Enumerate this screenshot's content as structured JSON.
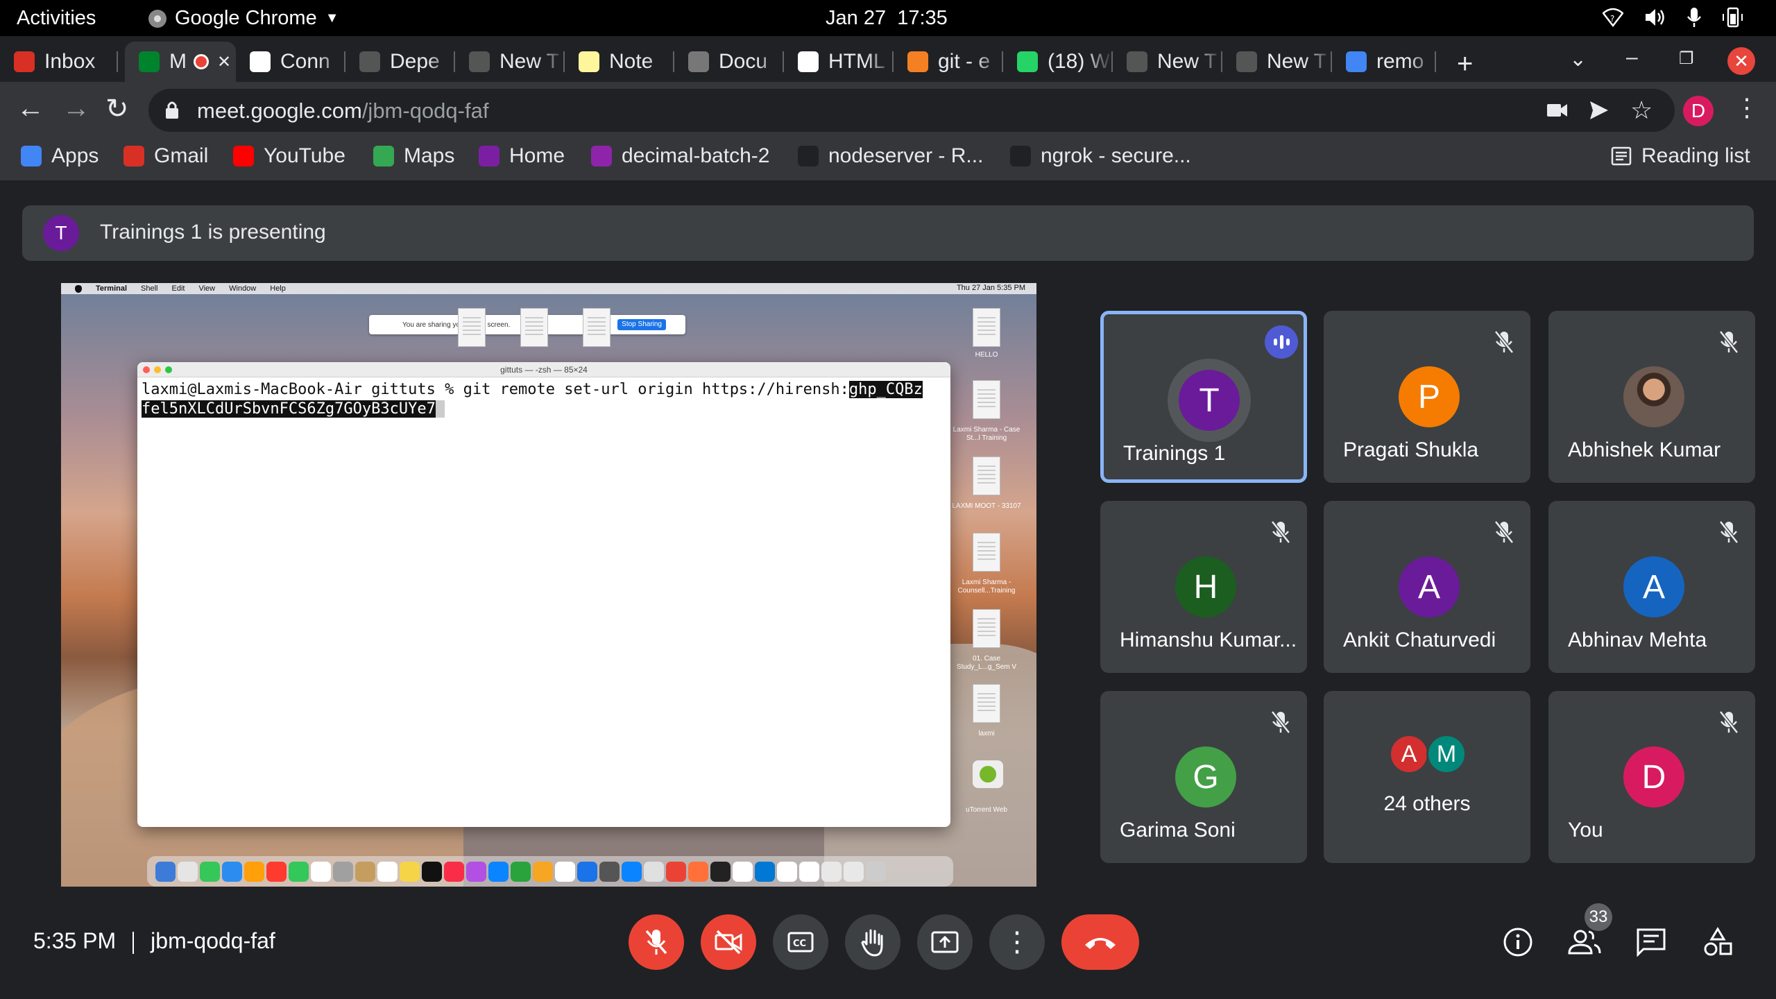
{
  "os_bar": {
    "activities": "Activities",
    "app_name": "Google Chrome",
    "date": "Jan 27",
    "time": "17:35"
  },
  "tabs": [
    {
      "label": "Inbox",
      "favicon": "gmail-icon",
      "color": "#d93025"
    },
    {
      "label": "M",
      "favicon": "meet-icon",
      "color": "#00832d",
      "active": true
    },
    {
      "label": "Conn",
      "favicon": "github-icon",
      "color": "#ffffff"
    },
    {
      "label": "Depe",
      "favicon": "github-icon",
      "color": "#555555"
    },
    {
      "label": "New T",
      "favicon": "chrome-icon",
      "color": "#555555"
    },
    {
      "label": "Note",
      "favicon": "note-icon",
      "color": "#fff59d"
    },
    {
      "label": "Docu",
      "favicon": "chrome-icon",
      "color": "#777777"
    },
    {
      "label": "HTML",
      "favicon": "html-icon",
      "color": "#ffffff"
    },
    {
      "label": "git - e",
      "favicon": "stackoverflow-icon",
      "color": "#f48024"
    },
    {
      "label": "(18) W",
      "favicon": "whatsapp-icon",
      "color": "#25d366"
    },
    {
      "label": "New T",
      "favicon": "chrome-icon",
      "color": "#555555"
    },
    {
      "label": "New T",
      "favicon": "chrome-icon",
      "color": "#555555"
    },
    {
      "label": "remo",
      "favicon": "google-icon",
      "color": "#4285f4"
    }
  ],
  "toolbar": {
    "url_domain": "meet.google.com",
    "url_path": "/jbm-qodq-faf",
    "profile_initial": "D"
  },
  "bookmarks": [
    {
      "label": "Apps",
      "icon": "apps-grid-icon",
      "color": "#4285f4"
    },
    {
      "label": "Gmail",
      "icon": "gmail-icon",
      "color": "#d93025"
    },
    {
      "label": "YouTube",
      "icon": "youtube-icon",
      "color": "#ff0000"
    },
    {
      "label": "Maps",
      "icon": "maps-icon",
      "color": "#34a853"
    },
    {
      "label": "Home",
      "icon": "home-logo-icon",
      "color": "#7b1fa2"
    },
    {
      "label": "decimal-batch-2",
      "icon": "batch-logo-icon",
      "color": "#8e24aa"
    },
    {
      "label": "nodeserver - R...",
      "icon": "replit-icon",
      "color": "#202124"
    },
    {
      "label": "ngrok - secure...",
      "icon": "ngrok-icon",
      "color": "#202124"
    }
  ],
  "reading_list": "Reading list",
  "presentation": {
    "initial": "T",
    "text": "Trainings 1 is presenting"
  },
  "shared_screen": {
    "menubar": [
      "Terminal",
      "Shell",
      "Edit",
      "View",
      "Window",
      "Help"
    ],
    "menubar_clock": "Thu 27 Jan  5:35 PM",
    "sharing_text": "You are sharing your entire screen.",
    "stop_sharing": "Stop Sharing",
    "terminal_title": "gittuts — -zsh — 85×24",
    "command_line": "laxmi@Laxmis-MacBook-Air gittuts % git remote set-url origin https://hirensh:",
    "token_part1": "ghp_CQBz",
    "token_part2": "fel5nXLCdUrSbvnFCS6Zg7GOyB3cUYe7",
    "desktop_labels": [
      "HELLO",
      "Laxmi Sharma - Case St...l Training",
      "LAXMI MOOT - 33107",
      "Laxmi Sharma - Counsell...Training",
      "01. Case Study_L...g_Sem V",
      "laxmi",
      "uTorrent Web"
    ]
  },
  "participants": [
    {
      "name": "Trainings 1",
      "initial": "T",
      "color": "#6a1b9a",
      "speaking": true
    },
    {
      "name": "Pragati Shukla",
      "initial": "P",
      "color": "#f57c00"
    },
    {
      "name": "Abhishek Kumar",
      "initial": "",
      "color": "#795548",
      "photo": true
    },
    {
      "name": "Himanshu Kumar...",
      "initial": "H",
      "color": "#1b5e20"
    },
    {
      "name": "Ankit Chaturvedi",
      "initial": "A",
      "color": "#6a1b9a"
    },
    {
      "name": "Abhinav Mehta",
      "initial": "A",
      "color": "#1565c0"
    },
    {
      "name": "Garima Soni",
      "initial": "G",
      "color": "#43a047"
    },
    {
      "name": "24 others",
      "others": true,
      "avatars": [
        {
          "initial": "A",
          "color": "#d32f2f"
        },
        {
          "initial": "M",
          "color": "#00897b"
        }
      ]
    },
    {
      "name": "You",
      "initial": "D",
      "color": "#d81b60"
    }
  ],
  "bottom": {
    "time": "5:35 PM",
    "meeting_code": "jbm-qodq-faf",
    "people_count": "33"
  }
}
